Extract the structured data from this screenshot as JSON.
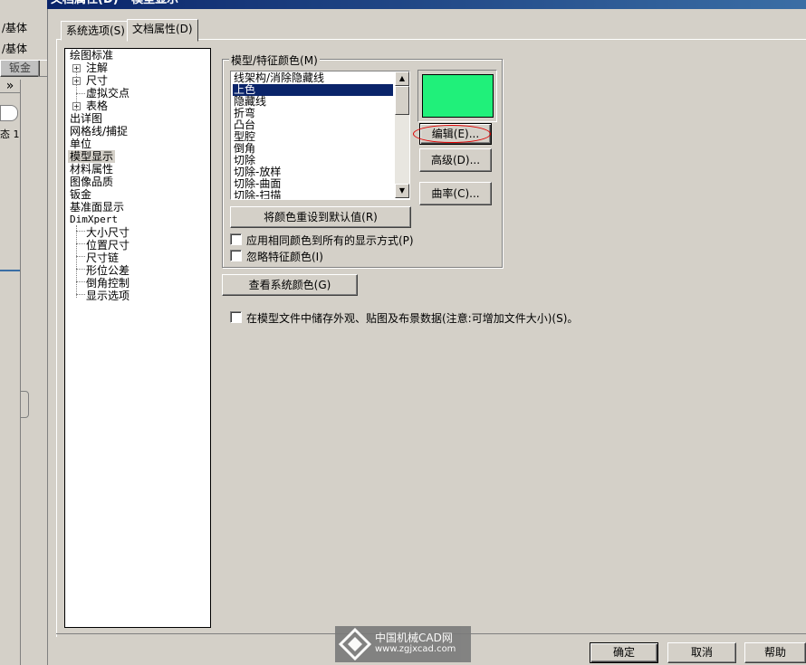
{
  "window": {
    "title": "文档属性(D) - 模型显示"
  },
  "left_pane": {
    "item1": "/基体",
    "item2": "/基体",
    "tab_label": "钣金",
    "expand_glyph": "»",
    "status_text": "态 1"
  },
  "tabs": [
    {
      "label": "系统选项(S)"
    },
    {
      "label": "文档属性(D)"
    }
  ],
  "tree": {
    "items": [
      {
        "label": "绘图标准"
      },
      {
        "label": "注解"
      },
      {
        "label": "尺寸"
      },
      {
        "label": "虚拟交点"
      },
      {
        "label": "表格"
      },
      {
        "label": "出详图"
      },
      {
        "label": "网格线/捕捉"
      },
      {
        "label": "单位"
      },
      {
        "label": "模型显示"
      },
      {
        "label": "材料属性"
      },
      {
        "label": "图像品质"
      },
      {
        "label": "钣金"
      },
      {
        "label": "基准面显示"
      },
      {
        "label": "DimXpert"
      },
      {
        "label": "大小尺寸"
      },
      {
        "label": "位置尺寸"
      },
      {
        "label": "尺寸链"
      },
      {
        "label": "形位公差"
      },
      {
        "label": "倒角控制"
      },
      {
        "label": "显示选项"
      }
    ]
  },
  "model_colors": {
    "group_label": "模型/特征颜色(M)",
    "list": [
      "线架构/消除隐藏线",
      "上色",
      "隐藏线",
      "折弯",
      "凸台",
      "型腔",
      "倒角",
      "切除",
      "切除-放样",
      "切除-曲面",
      "切除-扫描"
    ],
    "selected_index": 1,
    "swatch_color": "#20f07a",
    "edit_button": "编辑(E)...",
    "advanced_button": "高级(D)...",
    "curvature_button": "曲率(C)...",
    "reset_button": "将颜色重设到默认值(R)",
    "apply_same_color": "应用相同颜色到所有的显示方式(P)",
    "ignore_feature_color": "忽略特征颜色(I)"
  },
  "view_system_colors_button": "查看系统颜色(G)",
  "store_appearance_checkbox": "在模型文件中储存外观、贴图及布景数据(注意:可增加文件大小)(S)。",
  "footer": {
    "ok": "确定",
    "cancel": "取消",
    "help": "帮助"
  },
  "watermark": {
    "text": "中国机械CAD网",
    "url": "www.zgjxcad.com"
  }
}
